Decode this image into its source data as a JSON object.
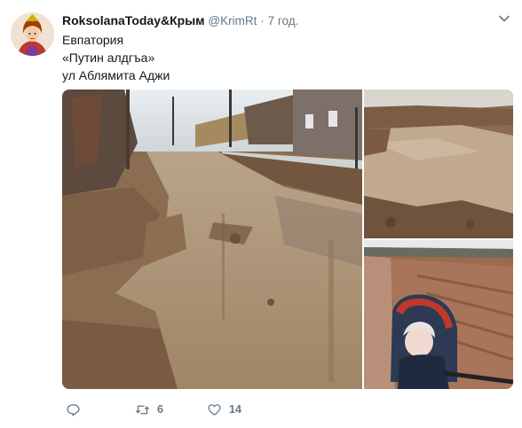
{
  "tweet": {
    "author_name": "RoksolanaToday&Крым",
    "handle": "@KrimRt",
    "separator": "·",
    "time": "7 год.",
    "lines": [
      "Евпатория",
      "«Путин алдгъа»",
      "ул Аблямита Аджи"
    ]
  },
  "media": {
    "photos": [
      {
        "subject": "muddy flooded street"
      },
      {
        "subject": "muddy puddle"
      },
      {
        "subject": "child in stroller on dirt road"
      }
    ]
  },
  "actions": {
    "retweet_count": "6",
    "like_count": "14"
  },
  "colors": {
    "text": "#14171a",
    "secondary": "#657786"
  },
  "icons": [
    "caret-down-icon",
    "reply-icon",
    "retweet-icon",
    "like-icon"
  ]
}
